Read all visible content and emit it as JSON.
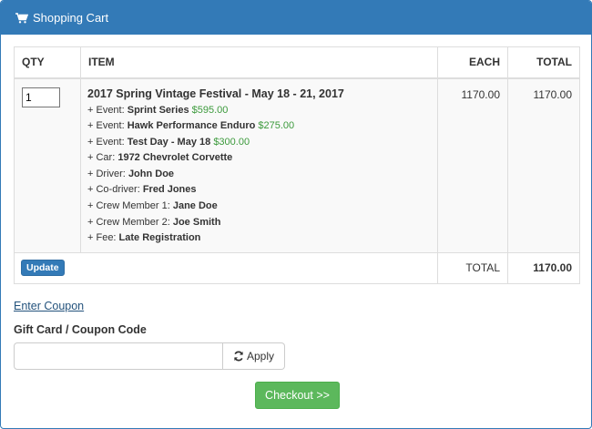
{
  "header": {
    "title": "Shopping Cart",
    "icon": "shopping-cart-icon"
  },
  "table": {
    "columns": {
      "qty": "QTY",
      "item": "ITEM",
      "each": "EACH",
      "total": "TOTAL"
    },
    "row": {
      "qty": "1",
      "title": "2017 Spring Vintage Festival - May 18 - 21, 2017",
      "lines": [
        {
          "prefix": "+ Event: ",
          "value": "Sprint Series",
          "price": "$595.00"
        },
        {
          "prefix": "+ Event: ",
          "value": "Hawk Performance Enduro",
          "price": "$275.00"
        },
        {
          "prefix": "+ Event: ",
          "value": "Test Day - May 18",
          "price": "$300.00"
        },
        {
          "prefix": "+ Car: ",
          "value": "1972 Chevrolet Corvette",
          "price": ""
        },
        {
          "prefix": "+ Driver: ",
          "value": "John Doe",
          "price": ""
        },
        {
          "prefix": "+ Co-driver: ",
          "value": "Fred Jones",
          "price": ""
        },
        {
          "prefix": "+ Crew Member 1: ",
          "value": "Jane Doe",
          "price": ""
        },
        {
          "prefix": "+ Crew Member 2: ",
          "value": "Joe Smith",
          "price": ""
        },
        {
          "prefix": "+ Fee: ",
          "value": "Late Registration",
          "price": ""
        }
      ],
      "each": "1170.00",
      "total": "1170.00"
    },
    "footer": {
      "update_label": "Update",
      "total_label": "TOTAL",
      "total_value": "1170.00"
    }
  },
  "coupon": {
    "link_text": "Enter Coupon",
    "label": "Gift Card / Coupon Code",
    "input_value": "",
    "apply_label": "Apply"
  },
  "checkout": {
    "label": "Checkout >>"
  },
  "colors": {
    "primary": "#337ab7",
    "success": "#5cb85c",
    "price_green": "#3c9a3c"
  }
}
